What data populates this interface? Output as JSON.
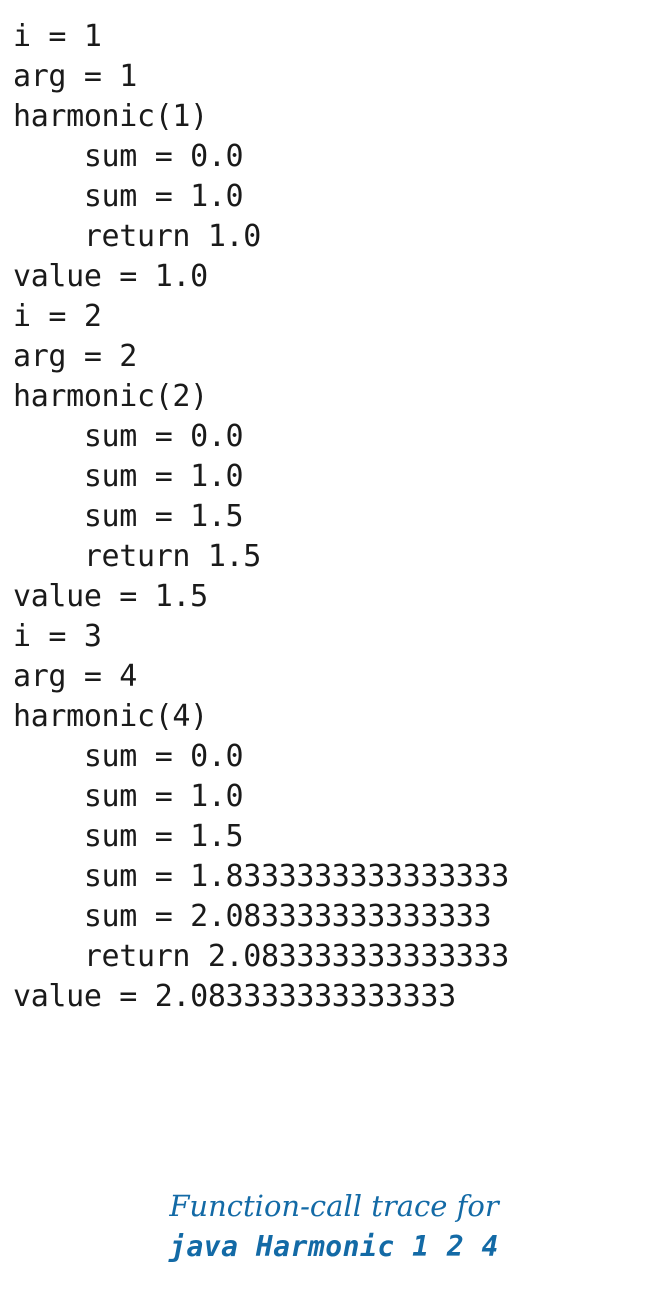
{
  "page": {
    "background_color": "#ffffff",
    "text_color": "#1a1a1a",
    "accent_color": "#136aa6"
  },
  "trace": {
    "lines": [
      "i = 1",
      "arg = 1",
      "harmonic(1)",
      "    sum = 0.0",
      "    sum = 1.0",
      "    return 1.0",
      "value = 1.0",
      "i = 2",
      "arg = 2",
      "harmonic(2)",
      "    sum = 0.0",
      "    sum = 1.0",
      "    sum = 1.5",
      "    return 1.5",
      "value = 1.5",
      "i = 3",
      "arg = 4",
      "harmonic(4)",
      "    sum = 0.0",
      "    sum = 1.0",
      "    sum = 1.5",
      "    sum = 1.8333333333333333",
      "    sum = 2.083333333333333",
      "    return 2.083333333333333",
      "value = 2.083333333333333"
    ]
  },
  "caption": {
    "line1": "Function-call trace for",
    "line2": "java Harmonic 1 2 4"
  }
}
